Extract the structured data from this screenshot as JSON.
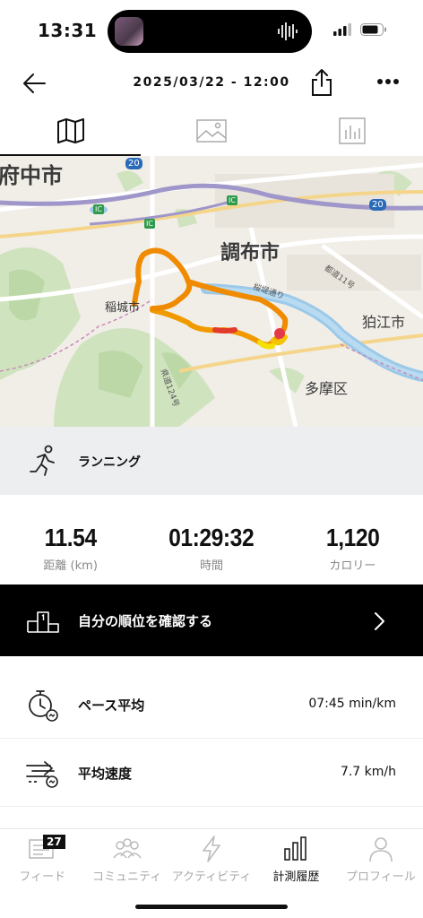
{
  "status": {
    "time": "13:31"
  },
  "header": {
    "title": "2025/03/22 - 12:00"
  },
  "tabs": [
    {
      "name": "map-tab",
      "icon": "map-icon"
    },
    {
      "name": "photo-tab",
      "icon": "image-icon"
    },
    {
      "name": "stats-tab",
      "icon": "bar-chart-icon"
    }
  ],
  "map": {
    "labels": {
      "fuchu": "府中市",
      "chofu": "調布市",
      "inagi": "稲城市",
      "komae": "狛江市",
      "tama": "多摩区",
      "sakuragawa": "桜堤通り",
      "todo11": "都道11号",
      "kendo124": "県道124号",
      "route20a": "20",
      "route20b": "20",
      "ic1": "IC",
      "ic2": "IC",
      "ic3": "IC"
    },
    "route_colors": [
      "#f08a00",
      "#f5c400",
      "#e23a2b"
    ]
  },
  "activity": {
    "type": "ランニング",
    "icon": "running-icon"
  },
  "stats": [
    {
      "value": "11.54",
      "label": "距離 (km)"
    },
    {
      "value": "01:29:32",
      "label": "時間"
    },
    {
      "value": "1,120",
      "label": "カロリー"
    }
  ],
  "rank": {
    "text": "自分の順位を確認する"
  },
  "metrics": [
    {
      "name": "ペース平均",
      "value": "07:45 min/km",
      "icon": "stopwatch-icon"
    },
    {
      "name": "平均速度",
      "value": "7.7 km/h",
      "icon": "speed-icon"
    }
  ],
  "nav": {
    "items": [
      {
        "label": "フィード",
        "icon": "feed-icon",
        "badge": "27"
      },
      {
        "label": "コミュニティ",
        "icon": "community-icon"
      },
      {
        "label": "アクティビティ",
        "icon": "activity-icon"
      },
      {
        "label": "計測履歴",
        "icon": "history-icon",
        "active": true
      },
      {
        "label": "プロフィール",
        "icon": "profile-icon"
      }
    ]
  }
}
